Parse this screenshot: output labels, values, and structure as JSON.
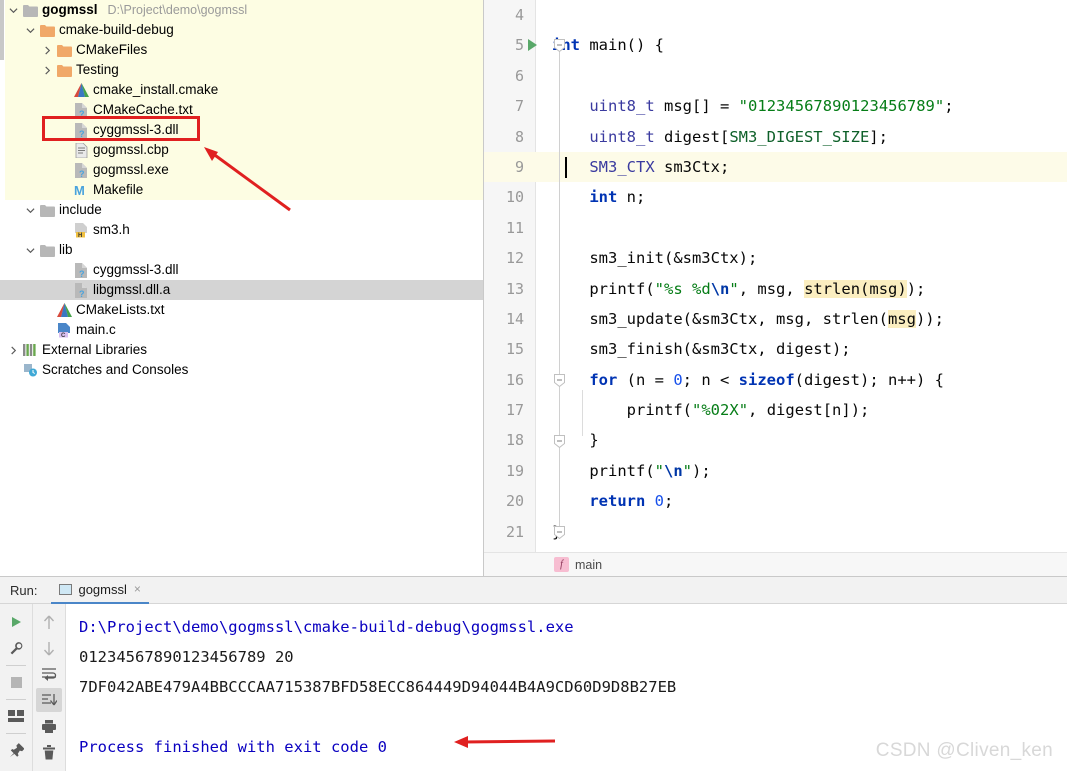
{
  "project": {
    "root_label": "gogmssl",
    "root_path": "D:\\Project\\demo\\gogmssl",
    "items": [
      {
        "label": "cmake-build-debug",
        "icon": "folder-orange-icon",
        "indent": 1,
        "twisty": "down",
        "selected": false
      },
      {
        "label": "CMakeFiles",
        "icon": "folder-orange-icon",
        "indent": 2,
        "twisty": "right",
        "selected": false
      },
      {
        "label": "Testing",
        "icon": "folder-orange-icon",
        "indent": 2,
        "twisty": "right",
        "selected": false
      },
      {
        "label": "cmake_install.cmake",
        "icon": "cmake-icon",
        "indent": 3,
        "twisty": "none",
        "selected": false
      },
      {
        "label": "CMakeCache.txt",
        "icon": "unknown-file-icon",
        "indent": 3,
        "twisty": "none",
        "selected": false
      },
      {
        "label": "cyggmssl-3.dll",
        "icon": "unknown-file-icon",
        "indent": 3,
        "twisty": "none",
        "selected": false
      },
      {
        "label": "gogmssl.cbp",
        "icon": "text-file-icon",
        "indent": 3,
        "twisty": "none",
        "selected": false
      },
      {
        "label": "gogmssl.exe",
        "icon": "unknown-file-icon",
        "indent": 3,
        "twisty": "none",
        "selected": false
      },
      {
        "label": "Makefile",
        "icon": "makefile-icon",
        "indent": 3,
        "twisty": "none",
        "selected": false
      },
      {
        "label": "include",
        "icon": "folder-gray-icon",
        "indent": 1,
        "twisty": "down",
        "selected": false
      },
      {
        "label": "sm3.h",
        "icon": "header-file-icon",
        "indent": 3,
        "twisty": "none",
        "selected": false
      },
      {
        "label": "lib",
        "icon": "folder-gray-icon",
        "indent": 1,
        "twisty": "down",
        "selected": false
      },
      {
        "label": "cyggmssl-3.dll",
        "icon": "unknown-file-icon",
        "indent": 3,
        "twisty": "none",
        "selected": false
      },
      {
        "label": "libgmssl.dll.a",
        "icon": "unknown-file-icon",
        "indent": 3,
        "twisty": "none",
        "selected": true
      },
      {
        "label": "CMakeLists.txt",
        "icon": "cmake-icon",
        "indent": 2,
        "twisty": "none",
        "selected": false
      },
      {
        "label": "main.c",
        "icon": "c-file-icon",
        "indent": 2,
        "twisty": "none",
        "selected": false
      },
      {
        "label": "External Libraries",
        "icon": "libraries-icon",
        "indent": 0,
        "twisty": "right",
        "selected": false
      },
      {
        "label": "Scratches and Consoles",
        "icon": "scratches-icon",
        "indent": 0,
        "twisty": "none",
        "selected": false
      }
    ],
    "annotation_color": "#e02020"
  },
  "editor": {
    "lines": [
      {
        "num": "4",
        "text": "",
        "current": false
      },
      {
        "num": "5",
        "text": "int main() {",
        "current": false
      },
      {
        "num": "6",
        "text": "",
        "current": false
      },
      {
        "num": "7",
        "text": "    uint8_t msg[] = \"01234567890123456789\";",
        "current": false
      },
      {
        "num": "8",
        "text": "    uint8_t digest[SM3_DIGEST_SIZE];",
        "current": false
      },
      {
        "num": "9",
        "text": "    SM3_CTX sm3Ctx;",
        "current": true
      },
      {
        "num": "10",
        "text": "    int n;",
        "current": false
      },
      {
        "num": "11",
        "text": "",
        "current": false
      },
      {
        "num": "12",
        "text": "    sm3_init(&sm3Ctx);",
        "current": false
      },
      {
        "num": "13",
        "text": "    printf(\"%s %d\\n\", msg, strlen(msg));",
        "current": false
      },
      {
        "num": "14",
        "text": "    sm3_update(&sm3Ctx, msg, strlen(msg));",
        "current": false
      },
      {
        "num": "15",
        "text": "    sm3_finish(&sm3Ctx, digest);",
        "current": false
      },
      {
        "num": "16",
        "text": "    for (n = 0; n < sizeof(digest); n++) {",
        "current": false
      },
      {
        "num": "17",
        "text": "        printf(\"%02X\", digest[n]);",
        "current": false
      },
      {
        "num": "18",
        "text": "    }",
        "current": false
      },
      {
        "num": "19",
        "text": "    printf(\"\\n\");",
        "current": false
      },
      {
        "num": "20",
        "text": "    return 0;",
        "current": false
      },
      {
        "num": "21",
        "text": "}",
        "current": false
      }
    ],
    "breadcrumb_badge": "f",
    "breadcrumb_text": "main",
    "current_line_bg": "#fdfbe8",
    "highlight_bg": "#fbeec0"
  },
  "run_panel": {
    "label": "Run:",
    "tab_name": "gogmssl",
    "tab_close": "×",
    "toolbar_left": [
      {
        "name": "rerun-button",
        "icon": "play-icon"
      },
      {
        "name": "settings-button",
        "icon": "wrench-icon"
      },
      {
        "name": "stop-button",
        "icon": "stop-icon"
      },
      {
        "name": "layout-button",
        "icon": "layout-icon"
      },
      {
        "name": "pin-button",
        "icon": "pin-icon"
      }
    ],
    "toolbar_right": [
      {
        "name": "up-button",
        "icon": "arrow-up-icon"
      },
      {
        "name": "down-button",
        "icon": "arrow-down-icon"
      },
      {
        "name": "soft-wrap-button",
        "icon": "soft-wrap-icon"
      },
      {
        "name": "scroll-end-button",
        "icon": "scroll-to-end-icon"
      },
      {
        "name": "print-button",
        "icon": "printer-icon"
      },
      {
        "name": "clear-all-button",
        "icon": "trash-icon"
      }
    ],
    "console_lines": [
      {
        "text": "D:\\Project\\demo\\gogmssl\\cmake-build-debug\\gogmssl.exe",
        "style": "link"
      },
      {
        "text": "01234567890123456789 20",
        "style": "plain"
      },
      {
        "text": "7DF042ABE479A4BBCCCAA715387BFD58ECC864449D94044B4A9CD60D9D8B27EB",
        "style": "plain"
      },
      {
        "text": "",
        "style": "plain"
      },
      {
        "text": "Process finished with exit code 0",
        "style": "link"
      }
    ]
  },
  "watermark": "CSDN @Cliven_ken"
}
